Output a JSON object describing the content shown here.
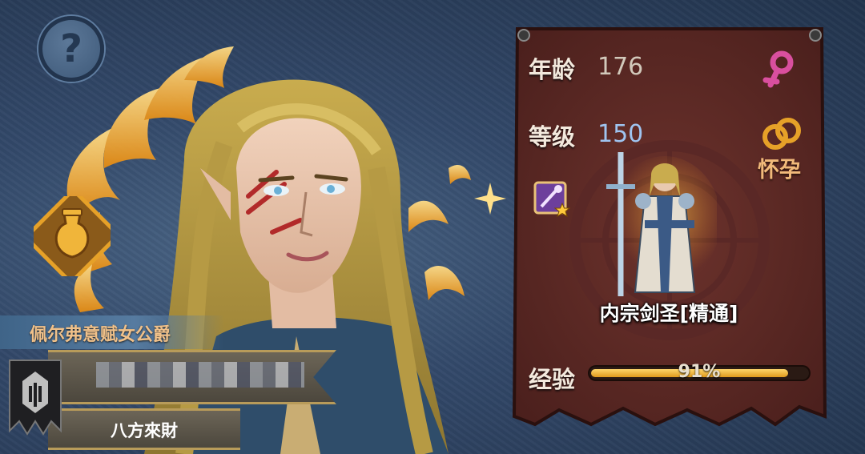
{
  "character": {
    "title": "佩尔弗意赋女公爵",
    "name": "",
    "nickname": "八方來財",
    "gender": "female",
    "pregnancy_status": "怀孕",
    "class_name": "内宗剑圣[精通]"
  },
  "stats": {
    "age_label": "年龄",
    "age_value": "176",
    "level_label": "等级",
    "level_value": "150",
    "exp_label": "经验",
    "exp_value": "91%",
    "exp_fraction": 0.91
  },
  "icons": {
    "help": "question-mark-icon",
    "gender": "female-symbol-icon",
    "pregnancy": "wedding-rings-icon",
    "skill": "magic-staff-icon",
    "potion": "potion-bottle-icon",
    "banner": "guild-banner-icon"
  },
  "colors": {
    "background": "#2c3e57",
    "panel": "#5a2a26",
    "accent_gold": "#e6a128",
    "female_icon": "#d94f9e",
    "level_text": "#9fc4f0"
  }
}
